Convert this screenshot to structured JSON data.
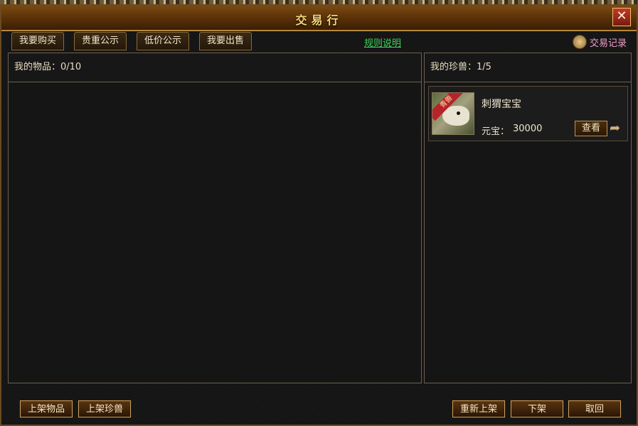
{
  "window": {
    "title": "交易行",
    "close_label": "✕"
  },
  "tabs": [
    {
      "label": "我要购买"
    },
    {
      "label": "贵重公示"
    },
    {
      "label": "低价公示"
    },
    {
      "label": "我要出售"
    }
  ],
  "rules_link": "规则说明",
  "trade_log": {
    "label": "交易记录",
    "icon": "scroll-icon"
  },
  "items_panel": {
    "header": "我的物品：0/10"
  },
  "beasts_panel": {
    "header": "我的珍兽：1/5",
    "beasts": [
      {
        "name": "刺猬宝宝",
        "badge": "青兽",
        "price_label": "元宝：",
        "price_value": "30000",
        "view_label": "查看",
        "icon": "hedgehog-icon"
      }
    ]
  },
  "bottom_buttons": {
    "list_item": "上架物品",
    "list_beast": "上架珍兽",
    "relist": "重新上架",
    "delist": "下架",
    "retrieve": "取回"
  }
}
